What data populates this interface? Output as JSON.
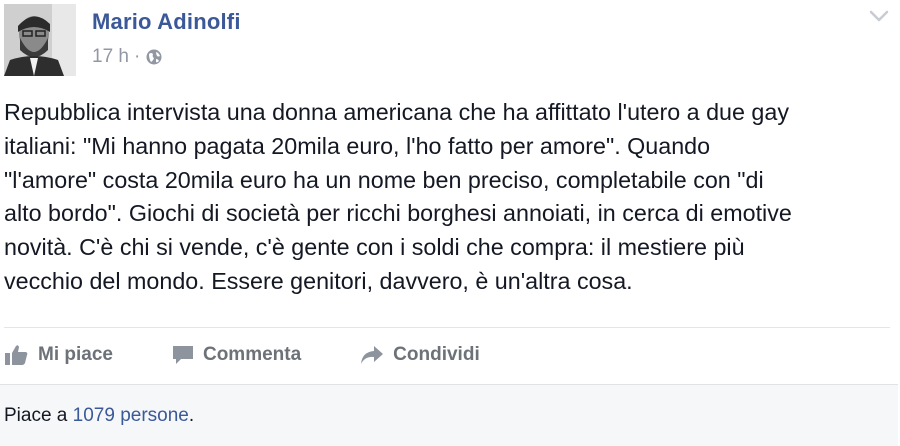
{
  "post": {
    "author": "Mario Adinolfi",
    "time": "17 h",
    "separator": "·",
    "privacy_icon": "globe-icon",
    "menu_icon": "chevron-down-icon",
    "lines": [
      "Repubblica intervista una donna americana che ha affittato l'utero a due gay",
      "italiani: \"Mi hanno pagata 20mila euro, l'ho fatto per amore\". Quando",
      "\"l'amore\" costa 20mila euro ha un nome ben preciso, completabile con \"di",
      "alto bordo\". Giochi di società per ricchi borghesi annoiati, in cerca di emotive",
      "novità. C'è chi si vende, c'è gente con i soldi che compra: il mestiere più",
      "vecchio del mondo. Essere genitori, davvero, è un'altra cosa."
    ]
  },
  "actions": {
    "like_label": "Mi piace",
    "comment_label": "Commenta",
    "share_label": "Condividi"
  },
  "likes": {
    "prefix": "Piace a ",
    "link": "1079 persone",
    "suffix": "."
  },
  "colors": {
    "link": "#3b5998",
    "muted": "#9197a3",
    "action": "#6d7178",
    "footer_bg": "#f6f7f9"
  }
}
